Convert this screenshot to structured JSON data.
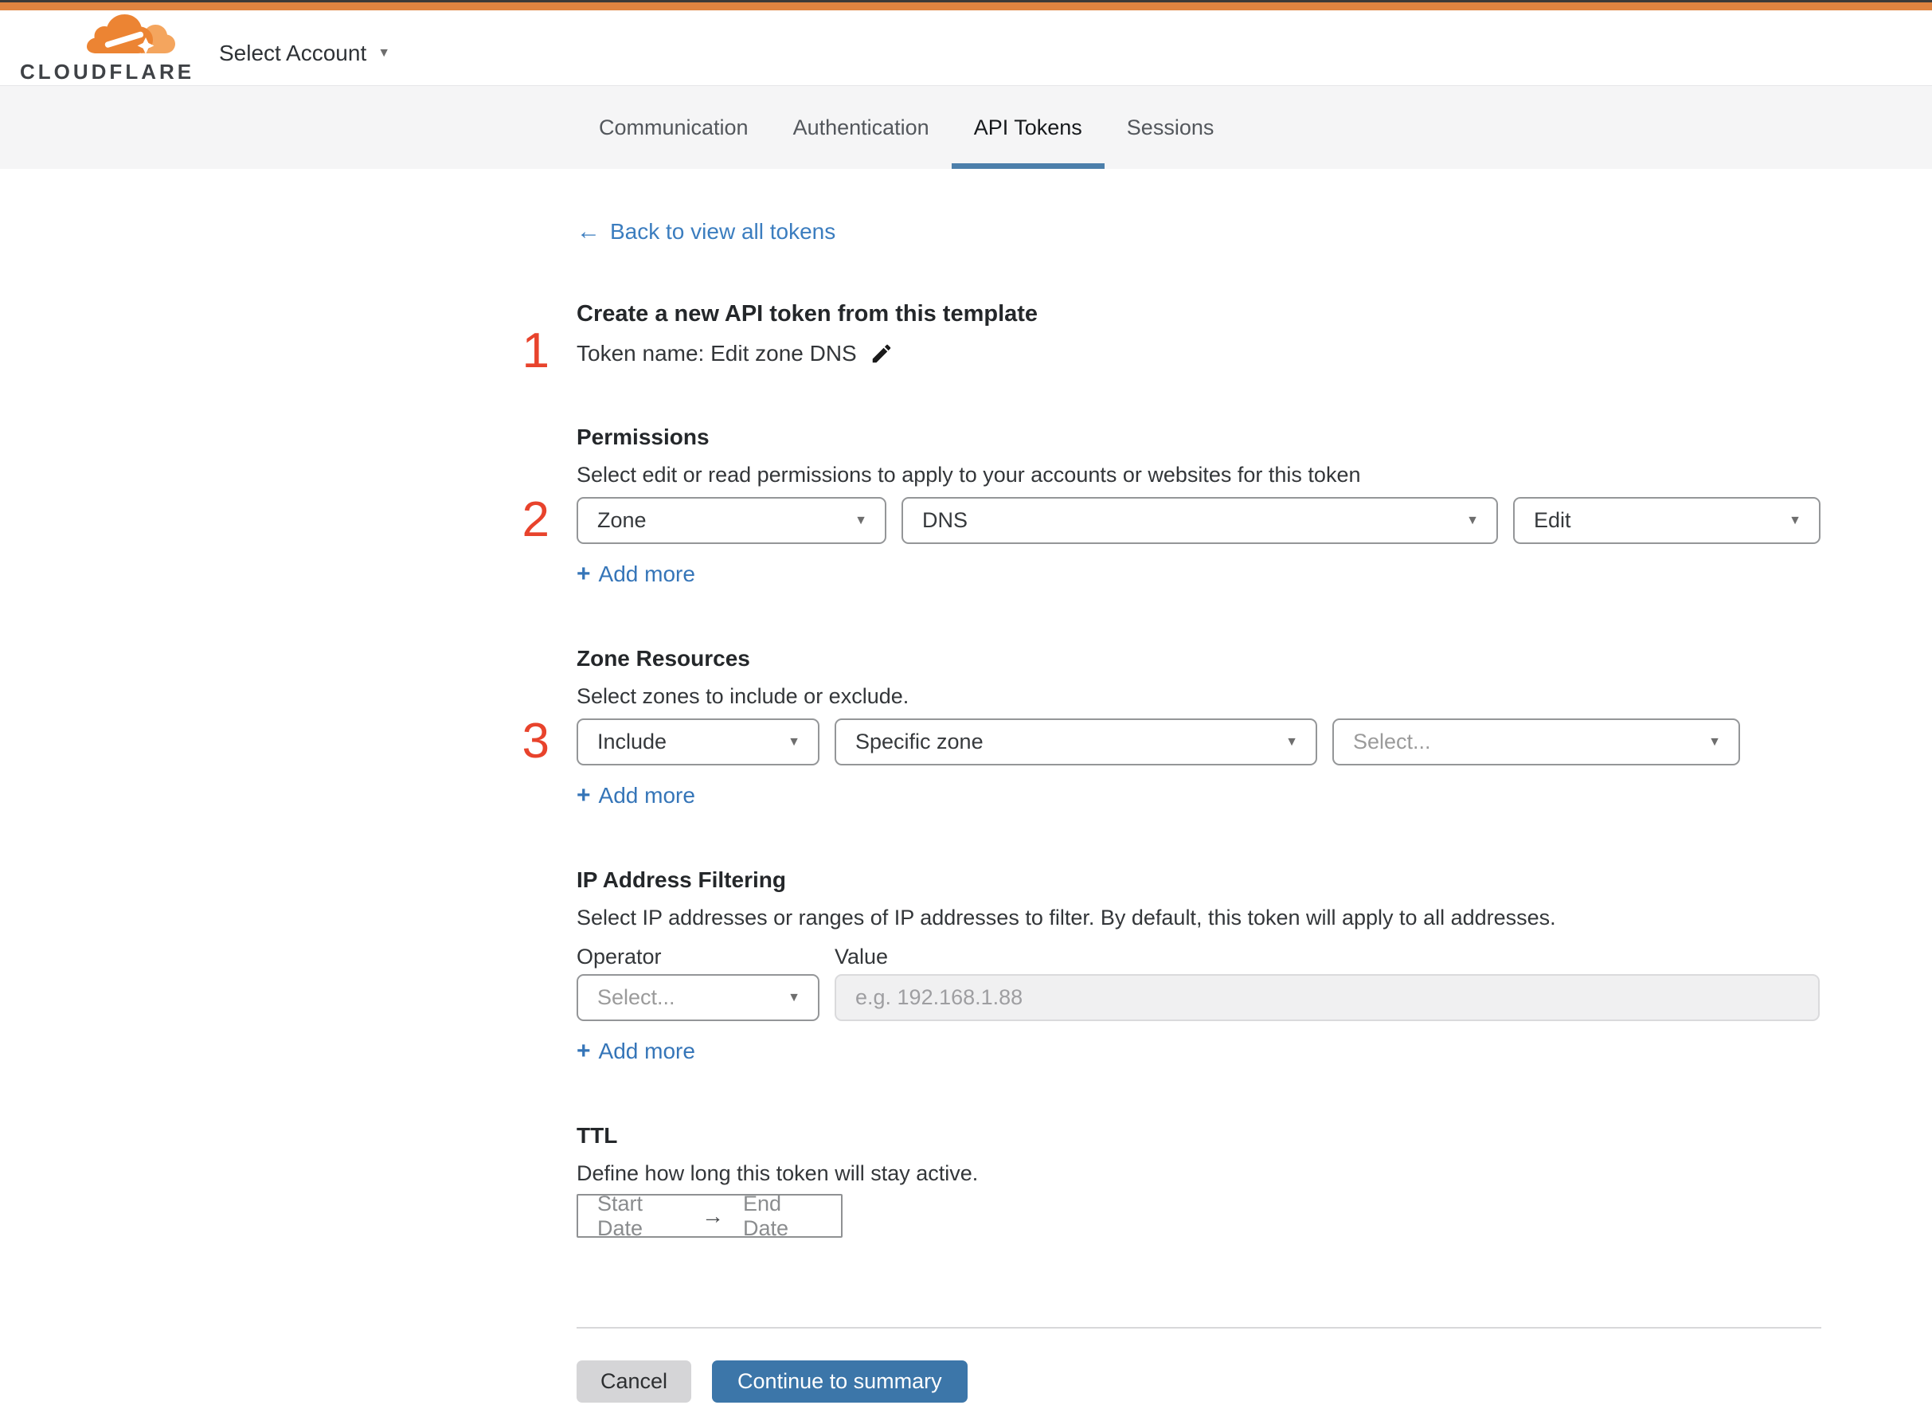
{
  "header": {
    "logo_text": "CLOUDFLARE",
    "account_selector": "Select Account"
  },
  "tabs": [
    {
      "label": "Communication",
      "active": false
    },
    {
      "label": "Authentication",
      "active": false
    },
    {
      "label": "API Tokens",
      "active": true
    },
    {
      "label": "Sessions",
      "active": false
    }
  ],
  "ui": {
    "back_arrow": "←",
    "caret": "▼",
    "plus": "+",
    "range_arrow": "→"
  },
  "back_link": "Back to view all tokens",
  "steps": {
    "one": "1",
    "two": "2",
    "three": "3"
  },
  "template_section": {
    "title": "Create a new API token from this template",
    "token_name_line": "Token name: Edit zone DNS"
  },
  "permissions": {
    "title": "Permissions",
    "description": "Select edit or read permissions to apply to your accounts or websites for this token",
    "selects": [
      {
        "value": "Zone"
      },
      {
        "value": "DNS"
      },
      {
        "value": "Edit"
      }
    ],
    "add_more": "Add more"
  },
  "zone_resources": {
    "title": "Zone Resources",
    "description": "Select zones to include or exclude.",
    "selects": [
      {
        "value": "Include"
      },
      {
        "value": "Specific zone"
      },
      {
        "value": "Select...",
        "is_placeholder": true
      }
    ],
    "add_more": "Add more"
  },
  "ip_filtering": {
    "title": "IP Address Filtering",
    "description": "Select IP addresses or ranges of IP addresses to filter. By default, this token will apply to all addresses.",
    "operator_label": "Operator",
    "value_label": "Value",
    "operator_value": "Select...",
    "value_placeholder": "e.g. 192.168.1.88",
    "add_more": "Add more"
  },
  "ttl": {
    "title": "TTL",
    "description": "Define how long this token will stay active.",
    "start_date": "Start Date",
    "end_date": "End Date"
  },
  "footer": {
    "cancel_label": "Cancel",
    "continue_label": "Continue to summary"
  },
  "colors": {
    "brand_bar": "#df8440",
    "logo_orange": "#ec8433",
    "logo_orange_light": "#f4a55e",
    "tabbar_bg": "#f5f5f6",
    "active_tab_underline": "#4c7fab",
    "link_blue": "#3b7dbf",
    "step_number_red": "#e8432c",
    "continue_button_blue": "#3c76a9",
    "cancel_button_gray": "#d5d5d7",
    "disabled_input_bg": "#f0f0f1"
  }
}
